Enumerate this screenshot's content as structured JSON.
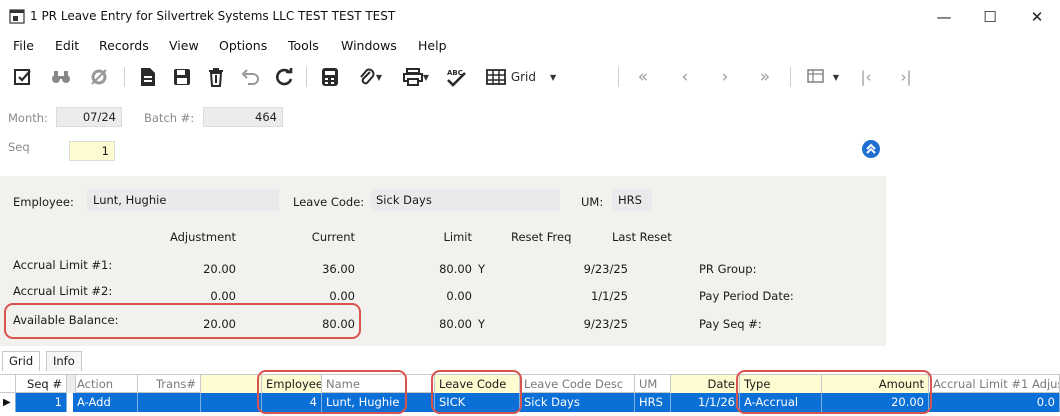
{
  "window": {
    "title": "1 PR Leave Entry for Silvertrek Systems LLC TEST TEST TEST",
    "minimize": "—",
    "maximize": "☐",
    "close": "✕"
  },
  "menu": [
    "File",
    "Edit",
    "Records",
    "View",
    "Options",
    "Tools",
    "Windows",
    "Help"
  ],
  "toolbar": {
    "grid_label": "Grid"
  },
  "header": {
    "month_label": "Month:",
    "month_value": "07/24",
    "batch_label": "Batch #:",
    "batch_value": "464",
    "seq_label": "Seq",
    "seq_value": "1"
  },
  "detail": {
    "employee_label": "Employee:",
    "employee_value": "Lunt, Hughie",
    "leave_code_label": "Leave Code:",
    "leave_code_value": "Sick Days",
    "um_label": "UM:",
    "um_value": "HRS",
    "columns": {
      "adjustment": "Adjustment",
      "current": "Current",
      "limit": "Limit",
      "reset_freq": "Reset Freq",
      "last_reset": "Last Reset"
    },
    "rows": [
      {
        "label": "Accrual Limit #1:",
        "adjustment": "20.00",
        "current": "36.00",
        "limit": "80.00",
        "reset_freq": "Y",
        "last_reset": "9/23/25",
        "side_label": "PR Group:"
      },
      {
        "label": "Accrual Limit #2:",
        "adjustment": "0.00",
        "current": "0.00",
        "limit": "0.00",
        "reset_freq": "",
        "last_reset": "1/1/25",
        "side_label": "Pay Period Date:"
      },
      {
        "label": "Available Balance:",
        "adjustment": "20.00",
        "current": "80.00",
        "limit": "80.00",
        "reset_freq": "Y",
        "last_reset": "9/23/25",
        "side_label": "Pay Seq #:"
      }
    ]
  },
  "tabs": [
    "Grid",
    "Info"
  ],
  "grid": {
    "headers": {
      "seq": "Seq #",
      "action": "Action",
      "trans": "Trans#",
      "employee": "Employee",
      "name": "Name",
      "leave_code": "Leave Code",
      "leave_code_desc": "Leave Code Desc",
      "um": "UM",
      "date": "Date",
      "type": "Type",
      "amount": "Amount",
      "accrual_adj": "Accrual Limit #1 Adjus"
    },
    "row": {
      "seq": "1",
      "action": "A-Add",
      "trans": "",
      "employee": "4",
      "name": "Lunt, Hughie",
      "leave_code": "SICK",
      "leave_code_desc": "Sick Days",
      "um": "HRS",
      "date": "1/1/26",
      "type": "A-Accrual",
      "amount": "20.00",
      "accrual_adj": "0.0"
    }
  },
  "colors": {
    "selection": "#0a6fd6",
    "highlight": "#d9534f",
    "required_field": "#fdfbd0"
  }
}
